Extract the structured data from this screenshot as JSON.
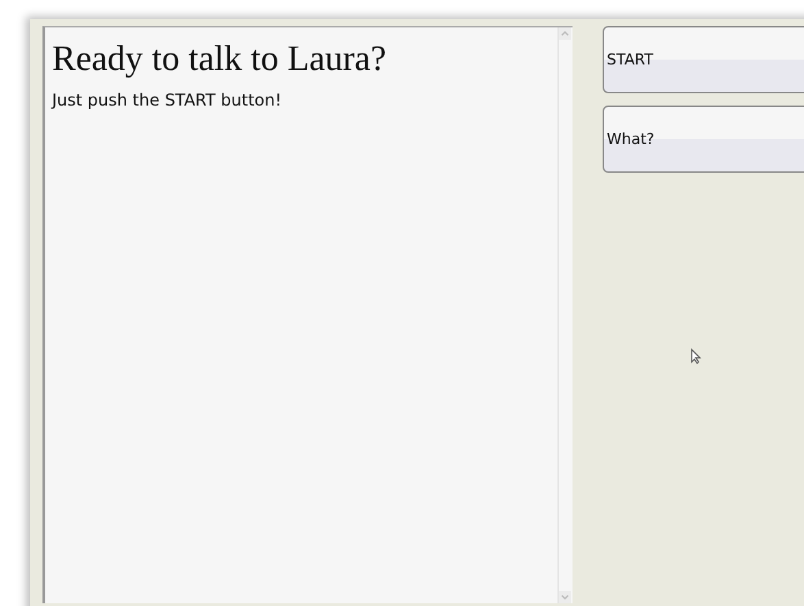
{
  "chat": {
    "heading": "Ready to talk to Laura?",
    "message": "Just push the START button!"
  },
  "buttons": [
    {
      "label": "START"
    },
    {
      "label": "What?"
    }
  ]
}
